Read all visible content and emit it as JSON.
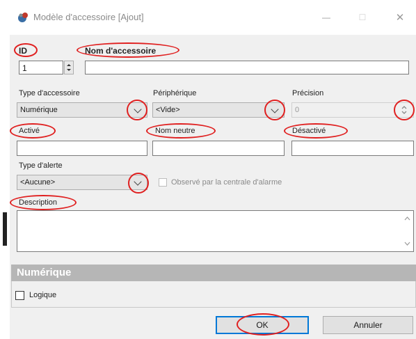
{
  "window": {
    "title": "Modèle d'accessoire [Ajout]",
    "minimize": "—",
    "maximize": "☐",
    "close": "✕"
  },
  "fields": {
    "id_label": "ID",
    "id_value": "1",
    "name_label": "Nom d'accessoire",
    "name_value": "",
    "type_label": "Type d'accessoire",
    "type_value": "Numérique",
    "peripheral_label": "Périphérique",
    "peripheral_value": "<Vide>",
    "precision_label": "Précision",
    "precision_value": "0",
    "active_label": "Activé",
    "neutral_label": "Nom neutre",
    "inactive_label": "Désactivé",
    "alert_label": "Type d'alerte",
    "alert_value": "<Aucune>",
    "observed_label": "Observé par la centrale d'alarme",
    "description_label": "Description"
  },
  "section": {
    "title": "Numérique",
    "logic_label": "Logique"
  },
  "buttons": {
    "ok": "OK",
    "cancel": "Annuler"
  },
  "colors": {
    "annotation": "#e02020",
    "focus": "#0078d7"
  }
}
